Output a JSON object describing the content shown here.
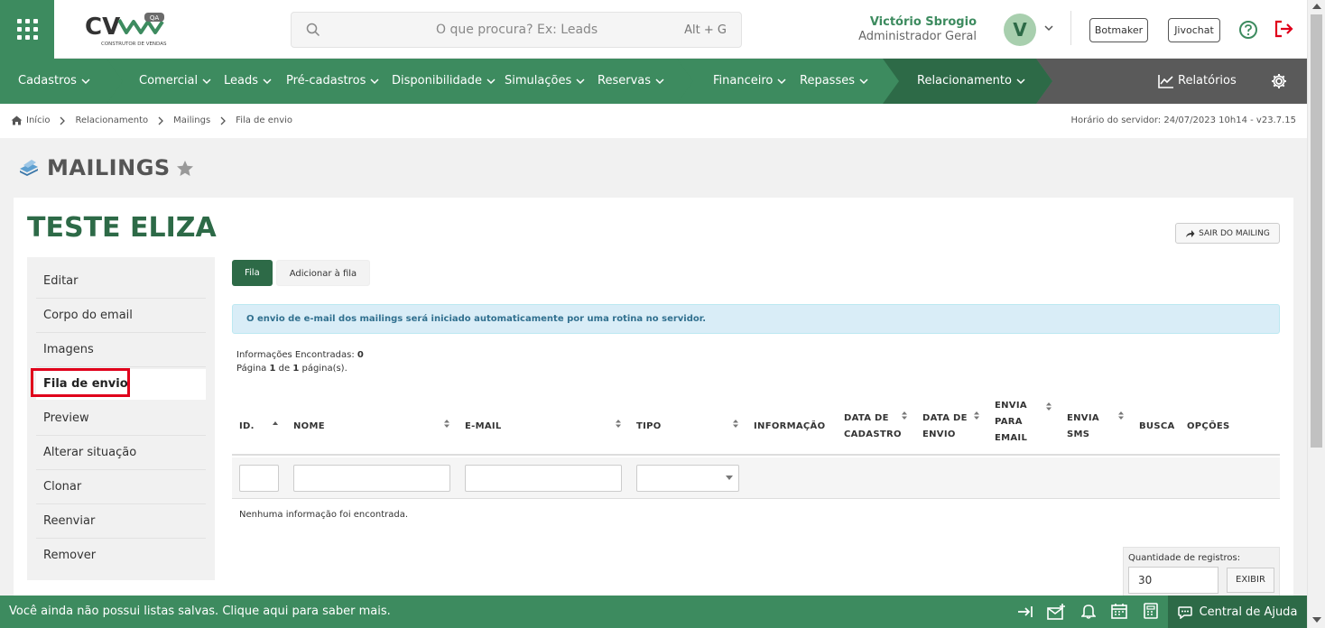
{
  "header": {
    "search": {
      "placeholder": "O que procura? Ex: Leads",
      "shortcut": "Alt + G"
    },
    "logo": {
      "mark": "CV",
      "badge": "QA",
      "tagline": "CONSTRUTOR DE VENDAS"
    },
    "user": {
      "name": "Victório Sbrogio",
      "role": "Administrador Geral",
      "initial": "V"
    },
    "chat_buttons": [
      "Botmaker",
      "Jivochat"
    ]
  },
  "nav": {
    "items": [
      "Cadastros",
      "Comercial",
      "Leads",
      "Pré-cadastros",
      "Disponibilidade",
      "Simulações",
      "Reservas",
      "Financeiro",
      "Repasses",
      "Relacionamento"
    ],
    "reports_label": "Relatórios",
    "colors": {
      "segment_dark": "#2d6a47",
      "segment_light": "#3d8b5f",
      "segment_gray": "#5a5a5a"
    }
  },
  "breadcrumb": {
    "items": [
      "Início",
      "Relacionamento",
      "Mailings",
      "Fila de envio"
    ],
    "server_time": "Horário do servidor: 24/07/2023 10h14 - v23.7.15"
  },
  "page": {
    "title": "MAILINGS"
  },
  "card": {
    "title": "TESTE ELIZA",
    "exit_label": "SAIR DO MAILING",
    "side_menu": [
      "Editar",
      "Corpo do email",
      "Imagens",
      "Fila de envio",
      "Preview",
      "Alterar situação",
      "Clonar",
      "Reenviar",
      "Remover"
    ],
    "tabs": [
      "Fila",
      "Adicionar à fila"
    ],
    "alert": "O envio de e-mail dos mailings será iniciado automaticamente por uma rotina no servidor.",
    "info": {
      "found_label": "Informações Encontradas:",
      "found_value": "0",
      "page_label": "Página",
      "page_value": "1",
      "page_of": "de",
      "page_total": "1",
      "page_suffix": "página(s)."
    },
    "table": {
      "columns": {
        "id": "ID.",
        "nome": "NOME",
        "email": "E-MAIL",
        "tipo": "TIPO",
        "informacao": "INFORMAÇÃO",
        "data_cadastro": [
          "DATA DE",
          "CADASTRO"
        ],
        "data_envio": [
          "DATA DE",
          "ENVIO"
        ],
        "envia_email": [
          "ENVIA",
          "PARA",
          "EMAIL"
        ],
        "envia_sms": [
          "ENVIA",
          "SMS"
        ],
        "busca": "BUSCA",
        "opcoes": "OPÇÕES"
      },
      "empty_message": "Nenhuma informação foi encontrada."
    },
    "qty": {
      "label": "Quantidade de registros:",
      "value": "30",
      "button": "EXIBIR"
    }
  },
  "footer": {
    "message": "Você ainda não possui listas salvas. Clique aqui para saber mais.",
    "help_center": "Central de Ajuda"
  }
}
